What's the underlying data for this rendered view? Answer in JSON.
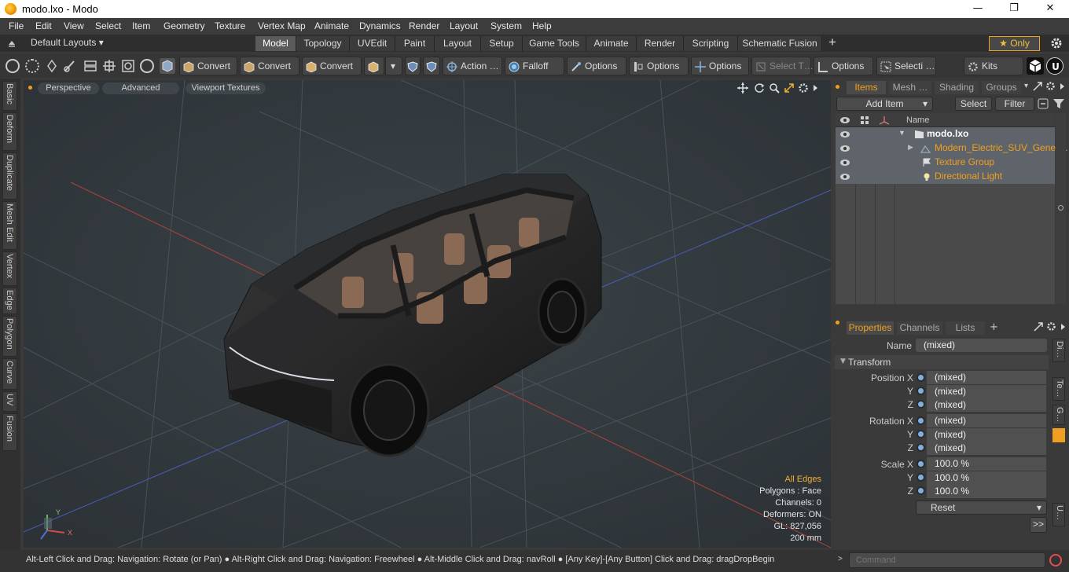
{
  "window": {
    "title": "modo.lxo - Modo",
    "minimize": "—",
    "maximize": "❐",
    "close": "✕"
  },
  "menu": [
    "File",
    "Edit",
    "View",
    "Select",
    "Item",
    "Geometry",
    "Texture",
    "Vertex Map",
    "Animate",
    "Dynamics",
    "Render",
    "Layout",
    "System",
    "Help"
  ],
  "layouts": {
    "default_label": "Default Layouts ▾",
    "tabs": [
      "Model",
      "Topology",
      "UVEdit",
      "Paint",
      "Layout",
      "Setup",
      "Game Tools",
      "Animate",
      "Render",
      "Scripting",
      "Schematic Fusion"
    ],
    "active": "Model",
    "add": "+",
    "only": "★  Only"
  },
  "toolbar": {
    "convert1": "Convert",
    "convert2": "Convert",
    "convert3": "Convert",
    "action": "Action  …",
    "falloff": "Falloff",
    "options1": "Options",
    "options2": "Options",
    "options3": "Options",
    "select_t": "Select T…",
    "options4": "Options",
    "selecti": "Selecti …",
    "kits": "Kits"
  },
  "left_tabs": [
    "Basic",
    "Deform",
    "Duplicate",
    "Mesh Edit",
    "Vertex",
    "Edge",
    "Polygon",
    "Curve",
    "UV",
    "Fusion"
  ],
  "viewport": {
    "perspective": "Perspective",
    "advanced": "Advanced",
    "textures": "Viewport Textures",
    "stats": {
      "all_edges": "All Edges",
      "polygons": "Polygons : Face",
      "channels": "Channels: 0",
      "deformers": "Deformers: ON",
      "gl": "GL: 827,056",
      "scale": "200 mm"
    },
    "axis_x": "X",
    "axis_y": "Y"
  },
  "items_panel": {
    "tabs": [
      "Items",
      "Mesh …",
      "Shading",
      "Groups"
    ],
    "active_tab": "Items",
    "add_item": "Add Item",
    "select": "Select",
    "filter": "Filter",
    "col_name": "Name",
    "rows": [
      {
        "name": "modo.lxo",
        "level": 0
      },
      {
        "name": "Modern_Electric_SUV_Gener…",
        "level": 1
      },
      {
        "name": "Texture Group",
        "level": 1
      },
      {
        "name": "Directional Light",
        "level": 1
      }
    ]
  },
  "properties": {
    "tabs": [
      "Properties",
      "Channels",
      "Lists"
    ],
    "active_tab": "Properties",
    "add": "+",
    "name_label": "Name",
    "name_value": "(mixed)",
    "section": "Transform",
    "position_x": "Position X",
    "pos_y": "Y",
    "pos_z": "Z",
    "rotation_x": "Rotation X",
    "rot_y": "Y",
    "rot_z": "Z",
    "scale_x": "Scale X",
    "scl_y": "Y",
    "scl_z": "Z",
    "values": {
      "px": "(mixed)",
      "py": "(mixed)",
      "pz": "(mixed)",
      "rx": "(mixed)",
      "ry": "(mixed)",
      "rz": "(mixed)",
      "sx": "100.0 %",
      "sy": "100.0 %",
      "sz": "100.0 %"
    },
    "reset": "Reset",
    "more": ">>",
    "side_tabs": [
      "Di…",
      "Te…",
      "G…",
      "U…"
    ]
  },
  "statusbar": {
    "hint": "Alt-Left Click and Drag: Navigation: Rotate (or Pan) ● Alt-Right Click and Drag: Navigation: Freewheel ● Alt-Middle Click and Drag: navRoll ● [Any Key]-[Any Button] Click and Drag: dragDropBegin",
    "command_placeholder": "Command"
  },
  "colors": {
    "accent": "#f0a020",
    "viewport_bg": "#333a3f",
    "panel_bg": "#3a3a3a",
    "selected_row": "#5e646a"
  }
}
